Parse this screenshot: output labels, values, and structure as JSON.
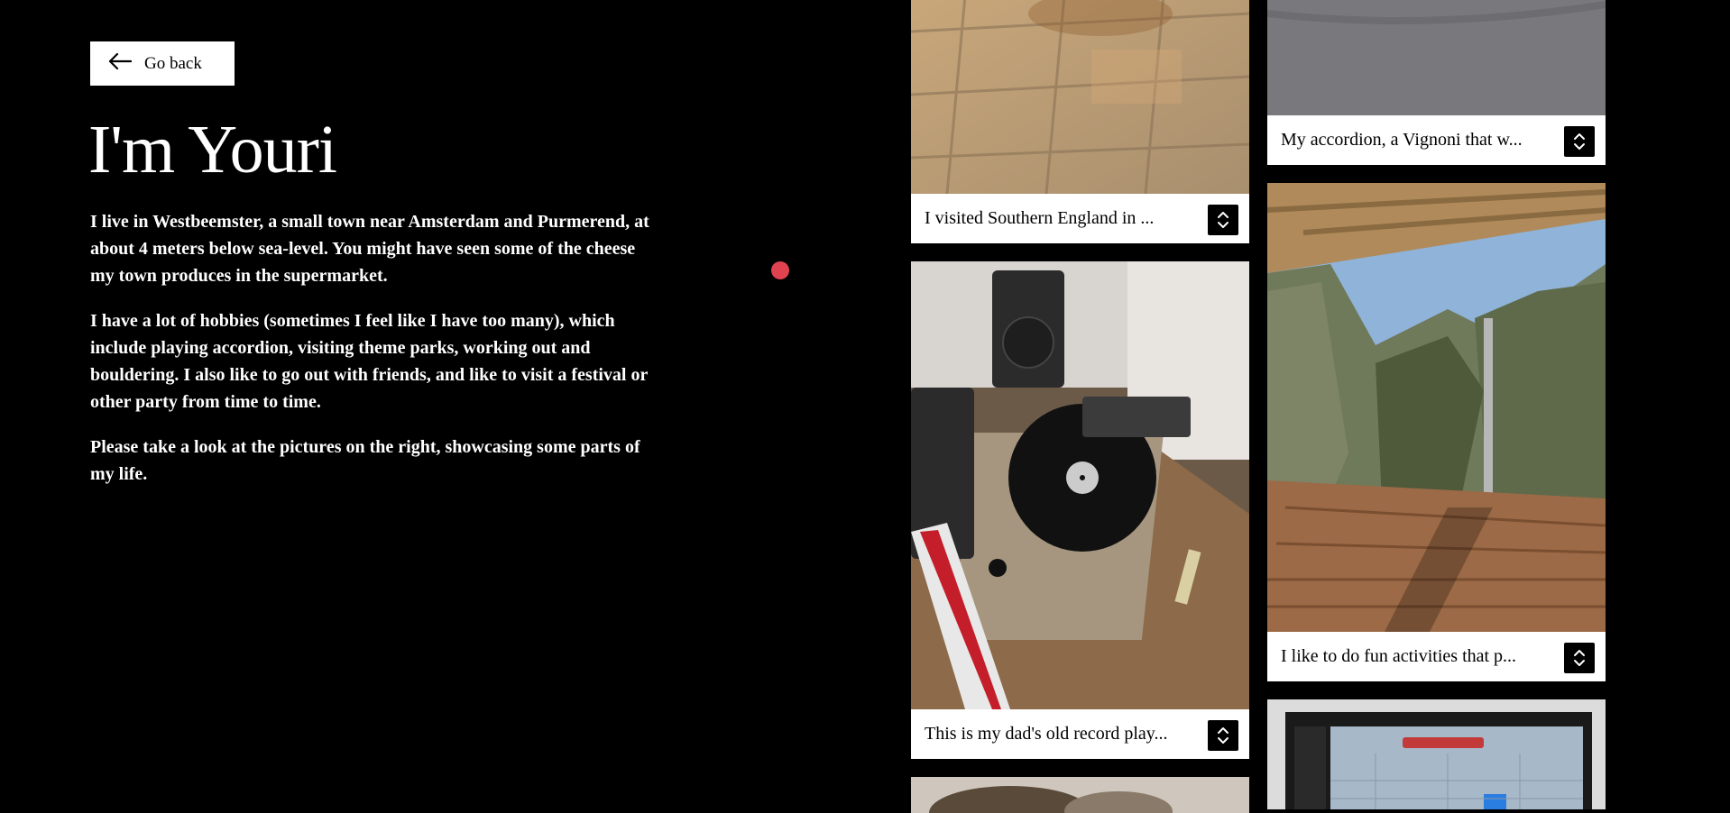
{
  "back_button": {
    "label": "Go back"
  },
  "heading": "I'm Youri",
  "bio": [
    "I live in Westbeemster, a small town near Amsterdam and Purmerend, at about 4 meters below sea-level. You might have seen some of the cheese my town produces in the supermarket.",
    "I have a lot of hobbies (sometimes I feel like I have too many), which include playing accordion, visiting theme parks, working out and bouldering. I also like to go out with friends, and like to visit a festival or other party from time to time.",
    "Please take a look at the pictures on the right, showcasing some parts of my life."
  ],
  "gallery": {
    "cards": [
      {
        "caption": "I visited Southern England in ...",
        "photo": "stone-floor-tiles"
      },
      {
        "caption": "This is my dad's old record play...",
        "photo": "record-player"
      },
      {
        "caption": "",
        "photo": "food-partial"
      },
      {
        "caption": "My accordion, a Vignoni that w...",
        "photo": "grey-carpet"
      },
      {
        "caption": "I like to do fun activities that p...",
        "photo": "canyon-view"
      },
      {
        "caption": "",
        "photo": "computer-screen-partial"
      }
    ]
  },
  "colors": {
    "background": "#000000",
    "accent_dot": "#e14250",
    "card": "#ffffff"
  }
}
